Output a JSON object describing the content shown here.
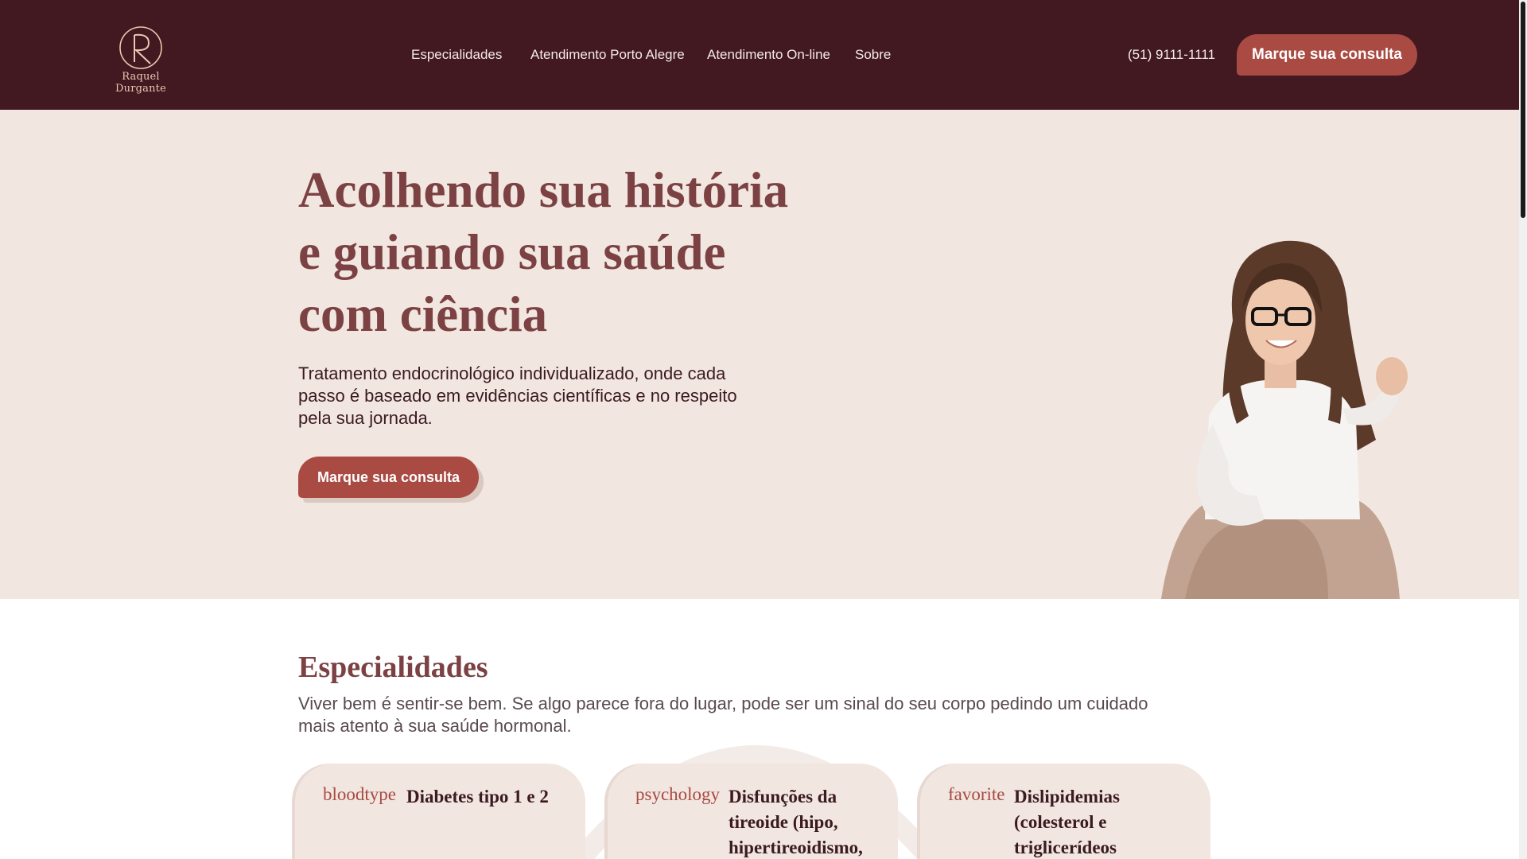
{
  "header": {
    "logo_name": "Raquel Durgante",
    "nav": [
      "Especialidades",
      "Atendimento Porto Alegre",
      "Atendimento On-line",
      "Sobre"
    ],
    "phone": "(51) 9111-1111",
    "cta_label": "Marque sua consulta"
  },
  "hero": {
    "title_lines": [
      "Acolhendo sua história",
      "e guiando sua saúde",
      "com ciência"
    ],
    "subtitle": "Tratamento endocrinológico individualizado, onde cada passo é baseado em evidências científicas e no respeito pela sua jornada.",
    "cta_label": "Marque sua consulta"
  },
  "specialties": {
    "title": "Especialidades",
    "description": "Viver bem é sentir-se bem. Se algo parece fora do lugar, pode ser um sinal do seu corpo pedindo um cuidado mais atento à sua saúde hormonal.",
    "cards": [
      {
        "icon": "bloodtype",
        "title": "Diabetes tipo 1 e 2"
      },
      {
        "icon": "psychology",
        "title": "Disfunções da tireoide (hipo, hipertireoidismo,"
      },
      {
        "icon": "favorite",
        "title": "Dislipidemias (colesterol e triglicerídeos"
      }
    ]
  },
  "colors": {
    "header_bg": "#421821",
    "hero_bg": "#f1e6e0",
    "accent": "#a94a43",
    "heading": "#7c4142"
  }
}
